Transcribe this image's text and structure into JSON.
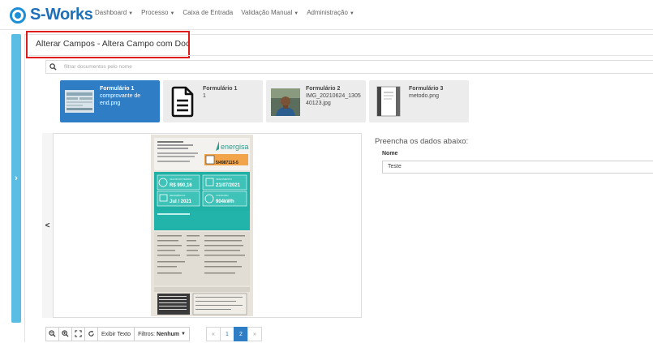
{
  "app": {
    "brand": "S-Works"
  },
  "nav": [
    {
      "label": "Dashboard",
      "dropdown": true
    },
    {
      "label": "Processo",
      "dropdown": true
    },
    {
      "label": "Caixa de Entrada",
      "dropdown": false
    },
    {
      "label": "Validação Manual",
      "dropdown": true
    },
    {
      "label": "Administração",
      "dropdown": true
    }
  ],
  "page": {
    "title": "Alterar Campos - Altera Campo com Doc"
  },
  "search": {
    "placeholder": "filtrar documentos pelo nome"
  },
  "documents": [
    {
      "name": "Formulário 1",
      "file": "comprovante de end.png",
      "thumb": "receipt-thumbnail",
      "selected": true
    },
    {
      "name": "Formulário 1",
      "file": "1",
      "thumb": "file-icon",
      "selected": false
    },
    {
      "name": "Formulário 2",
      "file": "IMG_20210624_130540123.jpg",
      "thumb": "photo-thumbnail",
      "selected": false
    },
    {
      "name": "Formulário 3",
      "file": "metodo.png",
      "thumb": "document-thumbnail",
      "selected": false
    }
  ],
  "viewer": {
    "prev_label": "<"
  },
  "bill": {
    "brand": "energisa",
    "amount_label": "VALOR DO PEDIDO",
    "amount": "R$ 990,16",
    "due_label": "VENCIMENTO",
    "due": "21/07/2021",
    "ref_label": "REFERÊNCIA",
    "ref": "Jul / 2021",
    "consumo_label": "CONSUMO",
    "consumo": "904kWh",
    "code": "5/4987115-5"
  },
  "form": {
    "heading": "Preencha os dados abaixo:",
    "fields": [
      {
        "label": "Nome",
        "value": "Teste"
      }
    ]
  },
  "toolbar": {
    "zoom_out_icon": "zoom-out-icon",
    "zoom_in_icon": "zoom-in-icon",
    "fit_icon": "expand-icon",
    "rotate_icon": "rotate-icon",
    "text_button": "Exibir Texto",
    "filter_prefix": "Filtros:",
    "filter_value": "Nenhum"
  },
  "pagination": {
    "prev": "«",
    "pages": [
      "1",
      "2"
    ],
    "current": "2",
    "next": "»"
  },
  "colors": {
    "accent": "#2f7dc4",
    "sidebar": "#5bbce4",
    "highlight_border": "#e01b1b",
    "bill_teal": "#1fb0a6"
  }
}
